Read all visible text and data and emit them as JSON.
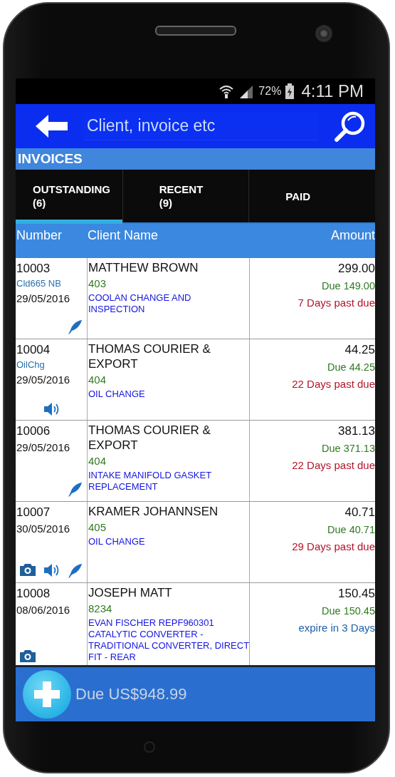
{
  "status_bar": {
    "battery": "72%",
    "time": "4:11 PM"
  },
  "search": {
    "placeholder": "Client, invoice etc"
  },
  "section_title": "INVOICES",
  "tabs": [
    {
      "label": "OUTSTANDING",
      "count": "(6)",
      "selected": true
    },
    {
      "label": "RECENT",
      "count": "(9)",
      "selected": false
    },
    {
      "label": "PAID",
      "selected": false
    }
  ],
  "columns": [
    "Number",
    "Client Name",
    "Amount"
  ],
  "rows": [
    {
      "number": "10003",
      "note": "Cld665 NB",
      "date": "29/05/2016",
      "client": "MATTHEW BROWN",
      "code": "403",
      "description": "COOLAN CHANGE AND INSPECTION",
      "amount": "299.00",
      "due": "Due 149.00",
      "status": {
        "kind": "past_due",
        "text": "7 Days past due"
      },
      "attachments": [
        {
          "kind": "pen"
        }
      ]
    },
    {
      "number": "10004",
      "note": "OilChg",
      "date": "29/05/2016",
      "client": "THOMAS  COURIER & EXPORT",
      "code": "404",
      "description": "OIL CHANGE",
      "amount": "44.25",
      "due": "Due 44.25",
      "status": {
        "kind": "past_due",
        "text": "22 Days past due"
      },
      "attachments": [
        {
          "kind": "audio"
        }
      ]
    },
    {
      "number": "10006",
      "date": "29/05/2016",
      "client": "THOMAS  COURIER & EXPORT",
      "code": "404",
      "description": "INTAKE MANIFOLD GASKET REPLACEMENT",
      "amount": "381.13",
      "due": "Due 371.13",
      "status": {
        "kind": "past_due",
        "text": "22 Days past due"
      },
      "attachments": [
        {
          "kind": "pen"
        }
      ]
    },
    {
      "number": "10007",
      "date": "30/05/2016",
      "client": "KRAMER JOHANNSEN",
      "code": "405",
      "description": "OIL CHANGE",
      "amount": "40.71",
      "due": "Due 40.71",
      "status": {
        "kind": "past_due",
        "text": "29 Days past due"
      },
      "attachments": [
        {
          "kind": "camera"
        },
        {
          "kind": "audio"
        },
        {
          "kind": "pen"
        }
      ]
    },
    {
      "number": "10008",
      "date": "08/06/2016",
      "client": "JOSEPH MATT",
      "code": "8234",
      "description": "EVAN FISCHER REPF960301 CATALYTIC CONVERTER - TRADITIONAL CONVERTER, DIRECT FIT - REAR",
      "amount": "150.45",
      "due": "Due 150.45",
      "status": {
        "kind": "expiring",
        "text": "expire in 3 Days"
      },
      "attachments": [
        {
          "kind": "camera"
        }
      ]
    }
  ],
  "footer": {
    "total": "Due US$948.99"
  }
}
